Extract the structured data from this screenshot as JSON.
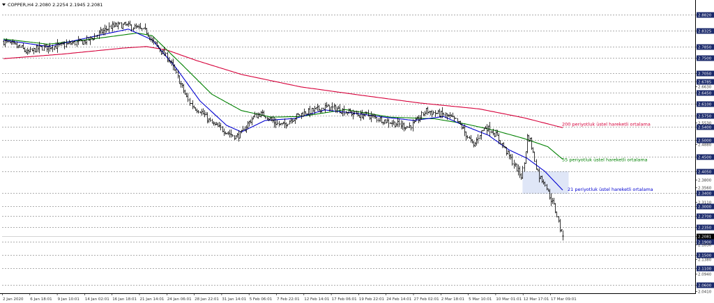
{
  "header": {
    "symbol_text": "COPPER,H4  2.2080 2.2254 2.1945 2.2081",
    "menu_icon": "triangle-down-icon"
  },
  "chart_data": {
    "type": "candlestick",
    "timeframe": "H4",
    "symbol": "COPPER",
    "last_ohlc": {
      "open": 2.208,
      "high": 2.2254,
      "low": 2.1945,
      "close": 2.2081
    },
    "ylim": [
      2.03,
      2.9
    ],
    "grid": true,
    "grid_style": "dashed-horizontal",
    "y_ticks": [
      {
        "value": 2.882,
        "label": "2.8820",
        "boxed": true
      },
      {
        "value": 2.8325,
        "label": "2.8325",
        "boxed": true
      },
      {
        "value": 2.785,
        "label": "2.7850",
        "boxed": true
      },
      {
        "value": 2.75,
        "label": "2.7500",
        "boxed": true
      },
      {
        "value": 2.705,
        "label": "2.7050",
        "boxed": true
      },
      {
        "value": 2.6785,
        "label": "2.6785",
        "boxed": true
      },
      {
        "value": 2.663,
        "label": "2.6630",
        "boxed": false
      },
      {
        "value": 2.645,
        "label": "2.6450",
        "boxed": true
      },
      {
        "value": 2.61,
        "label": "2.6100",
        "boxed": true
      },
      {
        "value": 2.575,
        "label": "2.5750",
        "boxed": true
      },
      {
        "value": 2.553,
        "label": "2.5530",
        "boxed": false
      },
      {
        "value": 2.54,
        "label": "2.5400",
        "boxed": true
      },
      {
        "value": 2.5,
        "label": "2.5000",
        "boxed": true
      },
      {
        "value": 2.488,
        "label": "2.4880",
        "boxed": false
      },
      {
        "value": 2.45,
        "label": "2.4500",
        "boxed": true
      },
      {
        "value": 2.405,
        "label": "2.4050",
        "boxed": true
      },
      {
        "value": 2.38,
        "label": "2.3800",
        "boxed": false
      },
      {
        "value": 2.356,
        "label": "2.3560",
        "boxed": false
      },
      {
        "value": 2.34,
        "label": "2.3400",
        "boxed": true
      },
      {
        "value": 2.311,
        "label": "2.3110",
        "boxed": false
      },
      {
        "value": 2.3,
        "label": "2.3000",
        "boxed": true
      },
      {
        "value": 2.27,
        "label": "2.2700",
        "boxed": true
      },
      {
        "value": 2.235,
        "label": "2.2350",
        "boxed": true
      },
      {
        "value": 2.2081,
        "label": "2.2081",
        "boxed": true,
        "current": true
      },
      {
        "value": 2.19,
        "label": "2.1900",
        "boxed": true
      },
      {
        "value": 2.183,
        "label": "2.1830",
        "boxed": false
      },
      {
        "value": 2.15,
        "label": "2.1500",
        "boxed": true
      },
      {
        "value": 2.138,
        "label": "2.1380",
        "boxed": false
      },
      {
        "value": 2.11,
        "label": "2.1100",
        "boxed": true
      },
      {
        "value": 2.094,
        "label": "2.0940",
        "boxed": false
      },
      {
        "value": 2.06,
        "label": "2.0600",
        "boxed": true
      },
      {
        "value": 2.041,
        "label": "2.0410",
        "boxed": false
      }
    ],
    "x_ticks": [
      "2 Jan 2020",
      "6 Jan 18:01",
      "9 Jan 10:01",
      "14 Jan 02:01",
      "16 Jan 18:01",
      "21 Jan 14:01",
      "24 Jan 06:01",
      "28 Jan 22:01",
      "31 Jan 14:01",
      "5 Feb 06:01",
      "7 Feb 22:01",
      "12 Feb 14:01",
      "17 Feb 06:01",
      "19 Feb 22:01",
      "24 Feb 14:01",
      "27 Feb 02:01",
      "2 Mar 18:01",
      "5 Mar 10:01",
      "10 Mar 01:01",
      "12 Mar 17:01",
      "17 Mar 09:01"
    ],
    "price_anchors": [
      [
        0,
        2.8
      ],
      [
        6,
        2.79
      ],
      [
        12,
        2.78
      ],
      [
        16,
        2.765
      ],
      [
        22,
        2.778
      ],
      [
        30,
        2.785
      ],
      [
        38,
        2.787
      ],
      [
        46,
        2.795
      ],
      [
        54,
        2.8
      ],
      [
        60,
        2.812
      ],
      [
        66,
        2.83
      ],
      [
        72,
        2.845
      ],
      [
        78,
        2.85
      ],
      [
        84,
        2.848
      ],
      [
        90,
        2.84
      ],
      [
        96,
        2.83
      ],
      [
        100,
        2.8
      ],
      [
        104,
        2.78
      ],
      [
        108,
        2.76
      ],
      [
        112,
        2.74
      ],
      [
        116,
        2.7
      ],
      [
        120,
        2.66
      ],
      [
        124,
        2.62
      ],
      [
        128,
        2.6
      ],
      [
        132,
        2.59
      ],
      [
        136,
        2.57
      ],
      [
        140,
        2.55
      ],
      [
        144,
        2.54
      ],
      [
        148,
        2.53
      ],
      [
        152,
        2.52
      ],
      [
        156,
        2.51
      ],
      [
        160,
        2.52
      ],
      [
        164,
        2.55
      ],
      [
        168,
        2.57
      ],
      [
        172,
        2.58
      ],
      [
        176,
        2.575
      ],
      [
        180,
        2.56
      ],
      [
        184,
        2.55
      ],
      [
        188,
        2.545
      ],
      [
        192,
        2.56
      ],
      [
        196,
        2.57
      ],
      [
        200,
        2.58
      ],
      [
        204,
        2.585
      ],
      [
        208,
        2.59
      ],
      [
        212,
        2.595
      ],
      [
        216,
        2.6
      ],
      [
        220,
        2.598
      ],
      [
        224,
        2.595
      ],
      [
        228,
        2.59
      ],
      [
        232,
        2.585
      ],
      [
        236,
        2.58
      ],
      [
        240,
        2.575
      ],
      [
        244,
        2.578
      ],
      [
        248,
        2.57
      ],
      [
        252,
        2.565
      ],
      [
        256,
        2.56
      ],
      [
        260,
        2.555
      ],
      [
        264,
        2.55
      ],
      [
        268,
        2.545
      ],
      [
        272,
        2.54
      ],
      [
        276,
        2.55
      ],
      [
        280,
        2.57
      ],
      [
        284,
        2.59
      ],
      [
        288,
        2.585
      ],
      [
        292,
        2.58
      ],
      [
        296,
        2.578
      ],
      [
        300,
        2.57
      ],
      [
        304,
        2.56
      ],
      [
        308,
        2.54
      ],
      [
        312,
        2.51
      ],
      [
        316,
        2.48
      ],
      [
        320,
        2.52
      ],
      [
        324,
        2.54
      ],
      [
        328,
        2.53
      ],
      [
        332,
        2.51
      ],
      [
        336,
        2.48
      ],
      [
        340,
        2.45
      ],
      [
        344,
        2.42
      ],
      [
        348,
        2.39
      ],
      [
        350,
        2.43
      ],
      [
        352,
        2.51
      ],
      [
        354,
        2.5
      ],
      [
        356,
        2.46
      ],
      [
        358,
        2.42
      ],
      [
        360,
        2.39
      ],
      [
        362,
        2.38
      ],
      [
        364,
        2.37
      ],
      [
        366,
        2.34
      ],
      [
        368,
        2.32
      ],
      [
        370,
        2.3
      ],
      [
        372,
        2.27
      ],
      [
        374,
        2.23
      ],
      [
        376,
        2.208
      ]
    ],
    "series": [
      {
        "name": "200 periyotluk üstel hareketli ortalama",
        "color": "#d6003a",
        "points": [
          [
            0,
            2.748
          ],
          [
            40,
            2.762
          ],
          [
            80,
            2.78
          ],
          [
            96,
            2.785
          ],
          [
            110,
            2.774
          ],
          [
            130,
            2.742
          ],
          [
            160,
            2.7
          ],
          [
            200,
            2.662
          ],
          [
            240,
            2.637
          ],
          [
            280,
            2.613
          ],
          [
            320,
            2.595
          ],
          [
            350,
            2.568
          ],
          [
            376,
            2.538
          ]
        ]
      },
      {
        "name": "55 periyotluk üstel hareketli ortalama",
        "color": "#008000",
        "points": [
          [
            0,
            2.808
          ],
          [
            30,
            2.792
          ],
          [
            60,
            2.808
          ],
          [
            90,
            2.826
          ],
          [
            100,
            2.818
          ],
          [
            120,
            2.73
          ],
          [
            140,
            2.64
          ],
          [
            160,
            2.59
          ],
          [
            180,
            2.57
          ],
          [
            200,
            2.572
          ],
          [
            230,
            2.593
          ],
          [
            260,
            2.57
          ],
          [
            290,
            2.565
          ],
          [
            310,
            2.55
          ],
          [
            330,
            2.53
          ],
          [
            350,
            2.505
          ],
          [
            366,
            2.48
          ],
          [
            376,
            2.442
          ]
        ]
      },
      {
        "name": "21 periyotluk üstel hareketli ortalama",
        "color": "#0000d0",
        "points": [
          [
            0,
            2.805
          ],
          [
            30,
            2.785
          ],
          [
            60,
            2.815
          ],
          [
            84,
            2.838
          ],
          [
            100,
            2.805
          ],
          [
            116,
            2.72
          ],
          [
            132,
            2.62
          ],
          [
            150,
            2.545
          ],
          [
            160,
            2.525
          ],
          [
            176,
            2.56
          ],
          [
            196,
            2.566
          ],
          [
            216,
            2.592
          ],
          [
            236,
            2.582
          ],
          [
            256,
            2.57
          ],
          [
            276,
            2.56
          ],
          [
            296,
            2.572
          ],
          [
            312,
            2.54
          ],
          [
            326,
            2.515
          ],
          [
            340,
            2.47
          ],
          [
            352,
            2.445
          ],
          [
            364,
            2.405
          ],
          [
            376,
            2.348
          ]
        ]
      }
    ],
    "annotations": [
      {
        "text": "200 periyotluk üstel hareketli ortalama",
        "color": "#d6003a",
        "value": 2.548
      },
      {
        "text": "55 periyotluk üstel hareketli ortalama",
        "color": "#008000",
        "value": 2.44
      },
      {
        "text": "21 periyotluk üstel hareketli ortalama",
        "color": "#0000d0",
        "value": 2.35
      }
    ],
    "highlight_zone": {
      "x_from": 349,
      "x_to": 380,
      "y_from": 2.337,
      "y_to": 2.405,
      "color": "#dfe6f7"
    }
  }
}
